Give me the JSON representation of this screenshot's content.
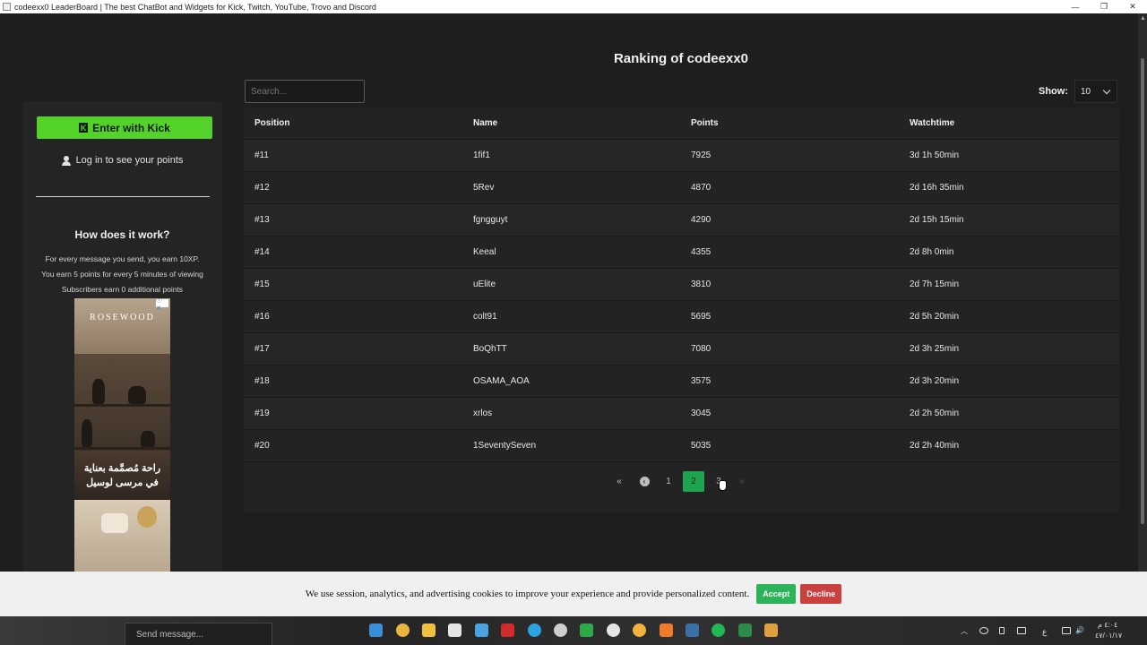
{
  "window": {
    "title": "codeexx0 LeaderBoard | The best ChatBot and Widgets for Kick, Twitch, YouTube, Trovo and Discord"
  },
  "page": {
    "title": "Ranking of codeexx0"
  },
  "sidebar": {
    "kick_button": "Enter with Kick",
    "kick_logo": "K",
    "login_text": "Log in to see your points",
    "how_title": "How does it work?",
    "how_lines": [
      "For every message you send, you earn 10XP.",
      "You earn 5 points for every 5 minutes of viewing",
      "Subscribers earn 0 additional points"
    ],
    "ad": {
      "brand": "ROSEWOOD",
      "choices": "ⓘ ✕",
      "arabic_line1": "راحة مُصمَّمة بعناية",
      "arabic_line2": "في مرسى لوسيل"
    }
  },
  "search": {
    "placeholder": "Search..."
  },
  "show": {
    "label": "Show:",
    "value": "10"
  },
  "table": {
    "headers": [
      "Position",
      "Name",
      "Points",
      "Watchtime"
    ],
    "rows": [
      [
        "#11",
        "1fif1",
        "7925",
        "3d 1h 50min"
      ],
      [
        "#12",
        "5Rev",
        "4870",
        "2d 16h 35min"
      ],
      [
        "#13",
        "fgngguyt",
        "4290",
        "2d 15h 15min"
      ],
      [
        "#14",
        "Keeal",
        "4355",
        "2d 8h 0min"
      ],
      [
        "#15",
        "uElite",
        "3810",
        "2d 7h 15min"
      ],
      [
        "#16",
        "colt91",
        "5695",
        "2d 5h 20min"
      ],
      [
        "#17",
        "BoQhTT",
        "7080",
        "2d 3h 25min"
      ],
      [
        "#18",
        "OSAMA_AOA",
        "3575",
        "2d 3h 20min"
      ],
      [
        "#19",
        "xrlos",
        "3045",
        "2d 2h 50min"
      ],
      [
        "#20",
        "1SeventySeven",
        "5035",
        "2d 2h 40min"
      ]
    ]
  },
  "pagination": {
    "first": "«",
    "prev": "‹",
    "pages": [
      "1",
      "2",
      "3"
    ],
    "active_page": "2",
    "last": "»"
  },
  "cookie": {
    "text": "We use session, analytics, and advertising cookies to improve your experience and provide personalized content.",
    "accept": "Accept",
    "decline": "Decline"
  },
  "taskbar": {
    "send_placeholder": "Send message...",
    "time": "٤:٠٤ م",
    "date": "٤٧/٠١/١٧",
    "lang": "ع"
  },
  "colors": {
    "kick_green": "#53d22a",
    "active_page": "#1ea34e",
    "accept": "#2db35a",
    "decline": "#c9403f"
  }
}
